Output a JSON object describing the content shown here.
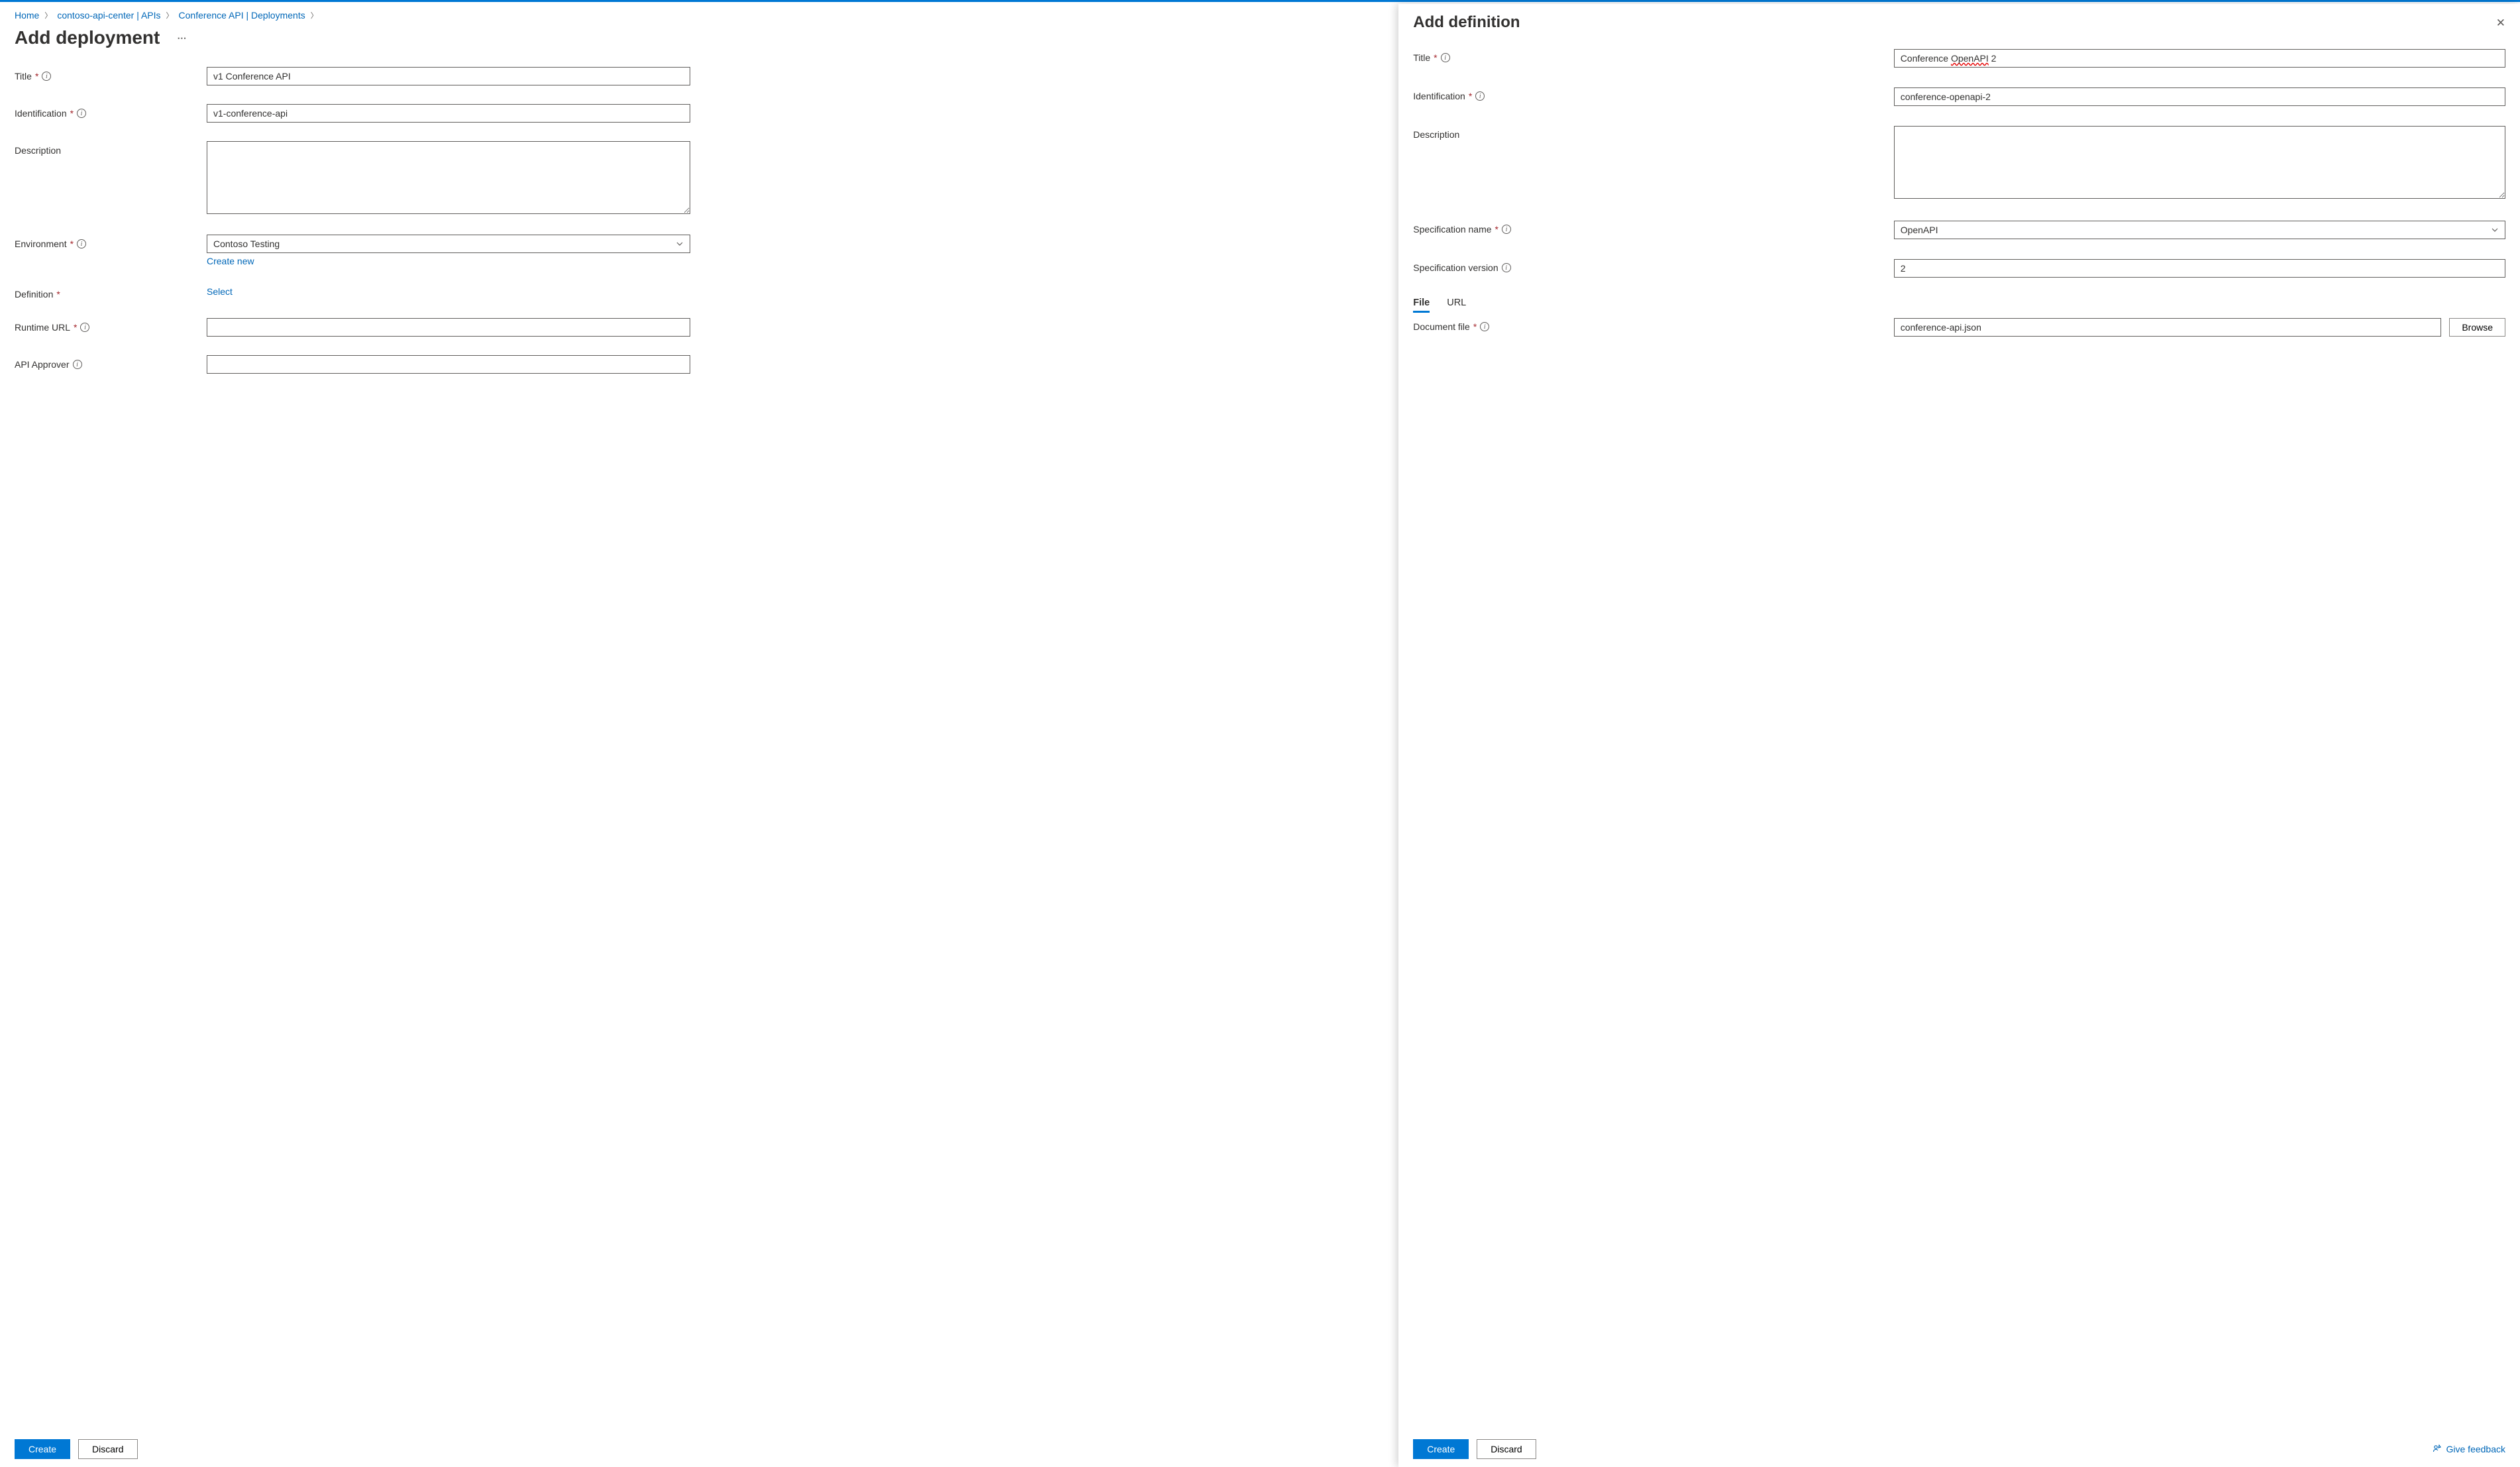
{
  "breadcrumb": {
    "items": [
      "Home",
      "contoso-api-center | APIs",
      "Conference API | Deployments"
    ]
  },
  "page": {
    "title": "Add deployment"
  },
  "form": {
    "title": {
      "label": "Title",
      "value": "v1 Conference API"
    },
    "identification": {
      "label": "Identification",
      "value": "v1-conference-api"
    },
    "description": {
      "label": "Description",
      "value": ""
    },
    "environment": {
      "label": "Environment",
      "value": "Contoso Testing",
      "create_new": "Create new"
    },
    "definition": {
      "label": "Definition",
      "select": "Select"
    },
    "runtime_url": {
      "label": "Runtime URL",
      "value": ""
    },
    "api_approver": {
      "label": "API Approver",
      "value": ""
    }
  },
  "footer": {
    "create": "Create",
    "discard": "Discard"
  },
  "panel": {
    "title": "Add definition",
    "fields": {
      "title": {
        "label": "Title",
        "value_pre": "Conference ",
        "squiggle": "OpenAPI",
        "value_post": " 2"
      },
      "identification": {
        "label": "Identification",
        "value": "conference-openapi-2"
      },
      "description": {
        "label": "Description",
        "value": ""
      },
      "spec_name": {
        "label": "Specification name",
        "value": "OpenAPI"
      },
      "spec_version": {
        "label": "Specification version",
        "value": "2"
      },
      "doc_file": {
        "label": "Document file",
        "value": "conference-api.json",
        "browse": "Browse"
      }
    },
    "tabs": {
      "file": "File",
      "url": "URL"
    },
    "footer": {
      "create": "Create",
      "discard": "Discard",
      "feedback": "Give feedback"
    }
  }
}
